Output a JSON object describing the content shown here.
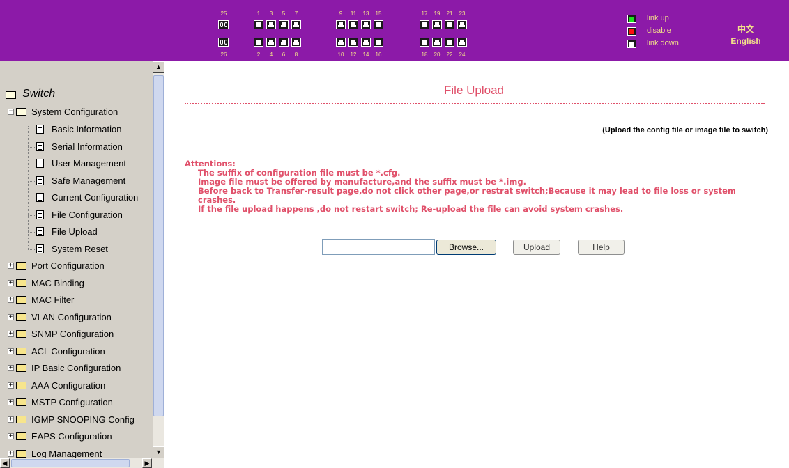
{
  "banner": {
    "ports_top": [
      {
        "label": "25",
        "kind": "sfp"
      },
      {
        "label": "1"
      },
      {
        "label": "3"
      },
      {
        "label": "5"
      },
      {
        "label": "7"
      },
      {
        "label": "9"
      },
      {
        "label": "11"
      },
      {
        "label": "13"
      },
      {
        "label": "15"
      },
      {
        "label": "17"
      },
      {
        "label": "19"
      },
      {
        "label": "21"
      },
      {
        "label": "23"
      }
    ],
    "ports_bottom": [
      {
        "label": "26",
        "kind": "sfp"
      },
      {
        "label": "2"
      },
      {
        "label": "4"
      },
      {
        "label": "6"
      },
      {
        "label": "8"
      },
      {
        "label": "10"
      },
      {
        "label": "12"
      },
      {
        "label": "14"
      },
      {
        "label": "16"
      },
      {
        "label": "18"
      },
      {
        "label": "20"
      },
      {
        "label": "22"
      },
      {
        "label": "24"
      }
    ],
    "legend": {
      "link_up": "link up",
      "disable": "disable",
      "link_down": "link down"
    },
    "lang_zh": "中文",
    "lang_en": "English",
    "colors": {
      "background": "#8c1aa8",
      "text": "#f2e08a"
    }
  },
  "sidebar": {
    "root": "Switch",
    "section_open": "System Configuration",
    "pages": [
      "Basic Information",
      "Serial Information",
      "User Management",
      "Safe Management",
      "Current Configuration",
      "File Configuration",
      "File Upload",
      "System Reset"
    ],
    "sections": [
      "Port Configuration",
      "MAC Binding",
      "MAC Filter",
      "VLAN Configuration",
      "SNMP Configuration",
      "ACL Configuration",
      "IP Basic Configuration",
      "AAA Configuration",
      "MSTP Configuration",
      "IGMP SNOOPING Config",
      "EAPS Configuration",
      "Log Management"
    ]
  },
  "main": {
    "title": "File Upload",
    "subtitle": "(Upload the config file or image file to switch)",
    "attentions": {
      "heading": "Attentions:",
      "line1": "The suffix of configuration file must be *.cfg.",
      "line2": "Image file must be offered by manufacture,and the suffix must be *.img.",
      "line3": "Before back to Transfer-result page,do not click other page,or restrat switch;Because it may lead to file loss or system crashes.",
      "line4": "If the file upload happens ,do not restart switch; Re-upload the file can avoid system crashes."
    },
    "file_input_value": "",
    "browse_label": "Browse...",
    "upload_label": "Upload",
    "help_label": "Help",
    "accent_color": "#e0506a"
  }
}
